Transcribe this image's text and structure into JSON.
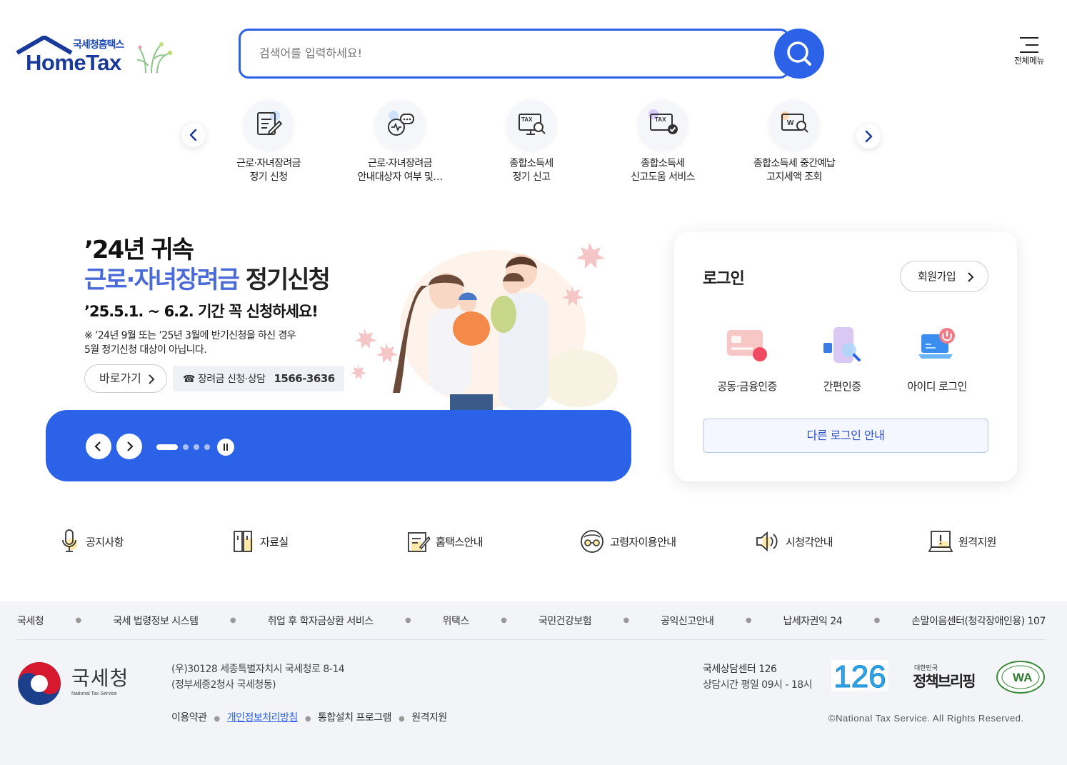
{
  "header": {
    "logo_sub": "국세청홈택스",
    "logo_main": "HomeTax",
    "search_placeholder": "검색어를 입력하세요!",
    "menu_label": "전체메뉴"
  },
  "quick_menu": [
    {
      "label": "근로·자녀장려금\n정기 신청",
      "icon": "application-form-icon"
    },
    {
      "label": "근로·자녀장려금\n안내대상자 여부 및…",
      "icon": "eligibility-check-icon"
    },
    {
      "label": "종합소득세\n정기 신고",
      "icon": "tax-monitor-search-icon"
    },
    {
      "label": "종합소득세\n신고도움 서비스",
      "icon": "tax-help-check-icon"
    },
    {
      "label": "종합소득세 중간예납\n고지세액 조회",
      "icon": "won-monitor-search-icon"
    }
  ],
  "banner": {
    "line1": "’24년 귀속",
    "line2_highlight": "근로·자녀장려금",
    "line2_rest": " 정기신청",
    "line3": "’25.5.1. ~ 6.2. 기간 꼭 신청하세요!",
    "note": "※ ’24년 9월 또는 ’25년 3월에 반기신청을 하신 경우\n    5월 정기신청 대상이 아닙니다.",
    "go_label": "바로가기",
    "phone_label": "☎ 장려금 신청·상담",
    "phone_number": "1566-3636",
    "slide_count": 4,
    "active_slide": 1
  },
  "login": {
    "title": "로그인",
    "join_label": "회원가입",
    "options": [
      {
        "label": "공동·금융인증",
        "icon": "certificate-card-icon"
      },
      {
        "label": "간편인증",
        "icon": "phone-auth-icon"
      },
      {
        "label": "아이디 로그인",
        "icon": "laptop-login-icon"
      }
    ],
    "other_label": "다른 로그인 안내"
  },
  "services": [
    {
      "label": "공지사항",
      "icon": "microphone-icon"
    },
    {
      "label": "자료실",
      "icon": "archive-icon"
    },
    {
      "label": "홈택스안내",
      "icon": "edit-guide-icon"
    },
    {
      "label": "고령자이용안내",
      "icon": "elderly-icon"
    },
    {
      "label": "시청각안내",
      "icon": "speaker-icon"
    },
    {
      "label": "원격지원",
      "icon": "remote-support-icon"
    }
  ],
  "footer": {
    "links": [
      "국세청",
      "국세 법령정보 시스템",
      "취업 후 학자금상환 서비스",
      "위택스",
      "국민건강보험",
      "공익신고안내",
      "납세자권익 24",
      "손말이음센터(청각장애인용) 107"
    ],
    "org_name": "국세청",
    "org_en": "National Tax Service",
    "address": "(우)30128 세종특별자치시 국세청로 8-14\n(정부세종2청사 국세청동)",
    "menu": [
      "이용약관",
      "개인정보처리방침",
      "통합설치 프로그램",
      "원격지원"
    ],
    "center_name": "국세상담센터 126",
    "center_hours": "상담시간 평일 09시 - 18시",
    "badge_126": "126",
    "policy_small": "대한민국",
    "policy_big": "정책브리핑",
    "wa_text": "WA",
    "copyright": "©National Tax Service. All Rights Reserved."
  },
  "colors": {
    "primary": "#2b62e8",
    "brand_dark": "#1a3a99",
    "highlight": "#4a6ad8",
    "footer_bg": "#f3f4f7"
  }
}
